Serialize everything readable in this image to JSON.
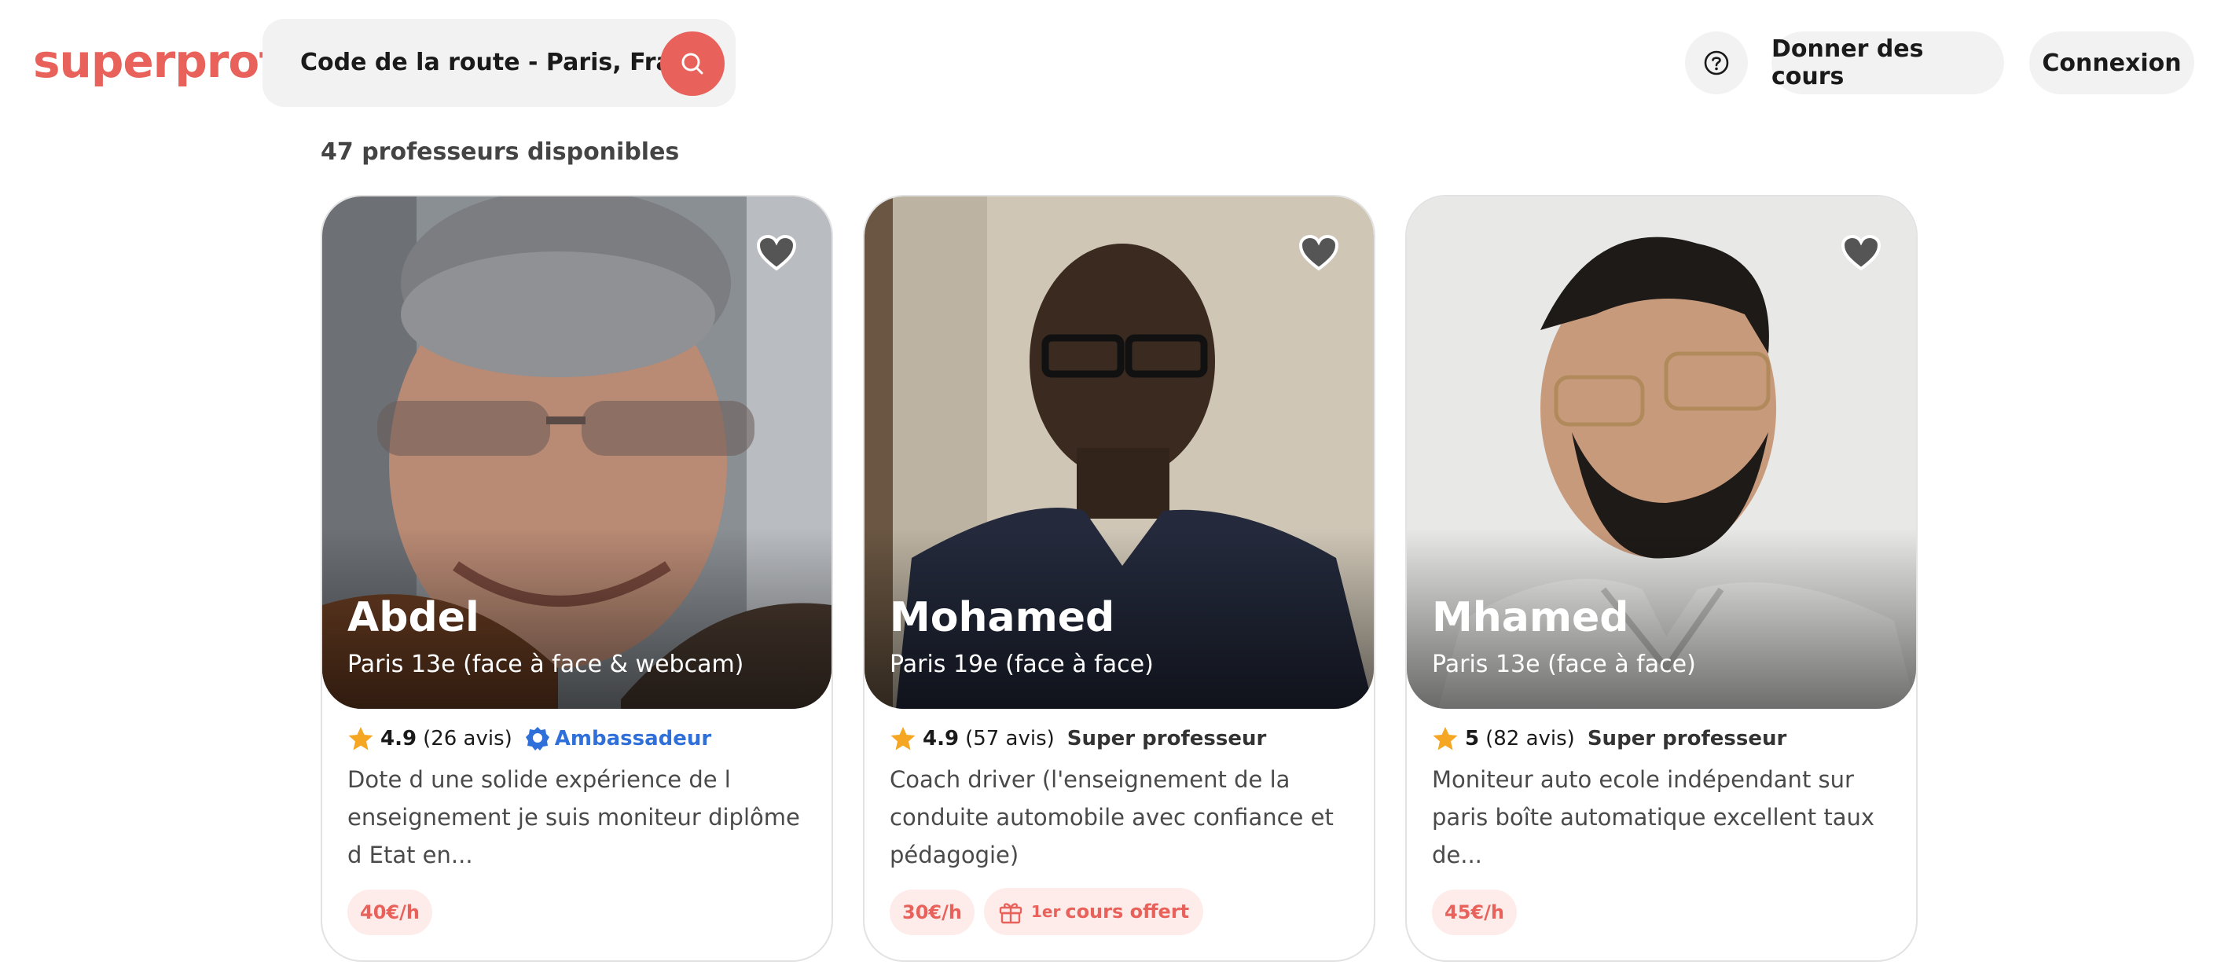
{
  "header": {
    "logo": "superprof",
    "search_value": "Code de la route - Paris, France",
    "give_lessons": "Donner des cours",
    "login": "Connexion"
  },
  "results": {
    "count_label": "47 professeurs disponibles"
  },
  "cards": [
    {
      "name": "Abdel",
      "location": "Paris 13e (face à face & webcam)",
      "rating": "4.9",
      "reviews": "(26 avis)",
      "badge": "Ambassadeur",
      "description": "Dote d une solide expérience de l enseignement je suis moniteur diplôme d Etat en...",
      "price": "40€/h"
    },
    {
      "name": "Mohamed",
      "location": "Paris 19e (face à face)",
      "rating": "4.9",
      "reviews": "(57 avis)",
      "badge": "Super professeur",
      "description": "Coach driver (l'enseignement de la conduite automobile avec confiance et pédagogie)",
      "price": "30€/h",
      "offer_sup": "1er",
      "offer": "cours offert"
    },
    {
      "name": "Mhamed",
      "location": "Paris 13e (face à face)",
      "rating": "5",
      "reviews": "(82 avis)",
      "badge": "Super professeur",
      "description": "Moniteur auto ecole indépendant sur paris boîte automatique excellent taux de...",
      "price": "45€/h"
    }
  ],
  "colors": {
    "brand": "#e8615a",
    "price_bg": "#fdecea",
    "ambassador": "#2e6fd9",
    "star": "#f5a623"
  }
}
